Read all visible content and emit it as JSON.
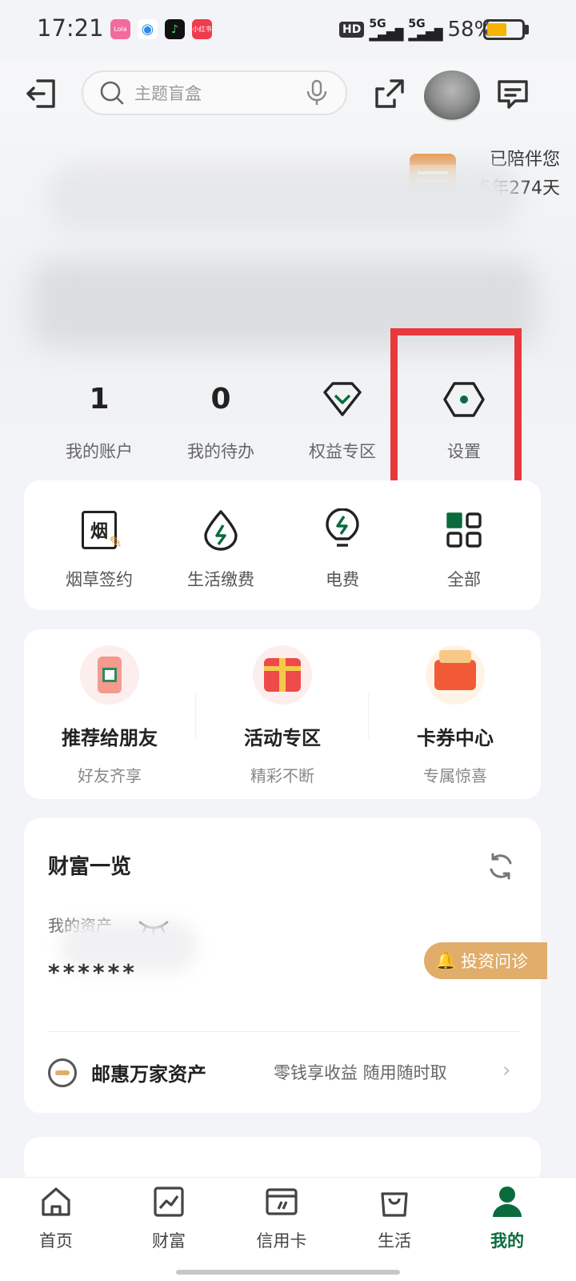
{
  "status_bar": {
    "time": "17:21",
    "battery": "58%",
    "network": "5G",
    "hd": "HD"
  },
  "header": {
    "search_placeholder": "主题盲盒"
  },
  "profile": {
    "accompany_line1": "已陪伴您",
    "accompany_line2": "5年274天"
  },
  "quick_stats": [
    {
      "value": "1",
      "label": "我的账户"
    },
    {
      "value": "0",
      "label": "我的待办"
    },
    {
      "label": "权益专区"
    },
    {
      "label": "设置"
    }
  ],
  "services": [
    {
      "label": "烟草签约",
      "icon_text": "烟"
    },
    {
      "label": "生活缴费"
    },
    {
      "label": "电费"
    },
    {
      "label": "全部"
    }
  ],
  "promotions": [
    {
      "title": "推荐给朋友",
      "subtitle": "好友齐享"
    },
    {
      "title": "活动专区",
      "subtitle": "精彩不断"
    },
    {
      "title": "卡券中心",
      "subtitle": "专属惊喜"
    }
  ],
  "wealth": {
    "title": "财富一览",
    "asset_label": "我的资产",
    "asset_value": "******",
    "invest_button": "投资问诊",
    "youhui_title": "邮惠万家资产",
    "youhui_desc": "零钱享收益 随用随时取"
  },
  "bottom_nav": [
    {
      "label": "首页"
    },
    {
      "label": "财富"
    },
    {
      "label": "信用卡"
    },
    {
      "label": "生活"
    },
    {
      "label": "我的",
      "active": true
    }
  ],
  "colors": {
    "brand_green": "#0a6b3c",
    "highlight_red": "#e8383d",
    "invest_gold": "#e0ad6b"
  }
}
